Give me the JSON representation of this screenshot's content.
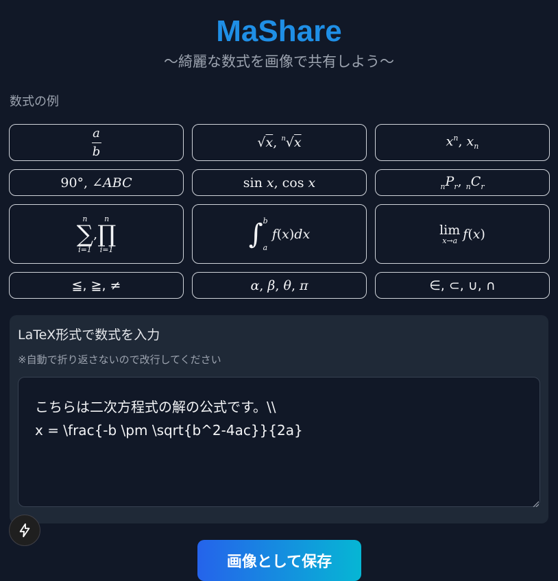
{
  "header": {
    "title": "MaShare",
    "subtitle": "〜綺麗な数式を画像で共有しよう〜"
  },
  "examples": {
    "label": "数式の例",
    "items": [
      {
        "id": "fraction",
        "latex": "\\frac{a}{b}"
      },
      {
        "id": "roots",
        "latex": "\\sqrt{x}, \\sqrt[n]{x}"
      },
      {
        "id": "powers",
        "latex": "x^n, x_n"
      },
      {
        "id": "angles",
        "text": "90°, ∠ABC"
      },
      {
        "id": "trig",
        "text": "sin x, cos x"
      },
      {
        "id": "perm-comb",
        "latex": "{}_nP_r, {}_nC_r"
      },
      {
        "id": "sum-prod",
        "latex": "\\sum_{i=1}^n, \\prod_{i=1}^n"
      },
      {
        "id": "integral",
        "latex": "\\int_a^b f(x)dx"
      },
      {
        "id": "limit",
        "latex": "\\lim_{x\\to a} f(x)"
      },
      {
        "id": "inequalities",
        "text": "≦, ≧, ≠"
      },
      {
        "id": "greek",
        "text": "α, β, θ, π"
      },
      {
        "id": "sets",
        "text": "∈, ⊂, ∪, ∩"
      }
    ]
  },
  "input": {
    "title": "LaTeX形式で数式を入力",
    "note": "※自動で折り返さないので改行してください",
    "value": "こちらは二次方程式の解の公式です。\\\\\nx = \\frac{-b \\pm \\sqrt{b^2-4ac}}{2a}"
  },
  "actions": {
    "save_label": "画像として保存"
  },
  "colors": {
    "background": "#111827",
    "title": "#1f8fe6",
    "card": "#1f2937",
    "button_gradient_start": "#2563eb",
    "button_gradient_end": "#06b6d4"
  }
}
